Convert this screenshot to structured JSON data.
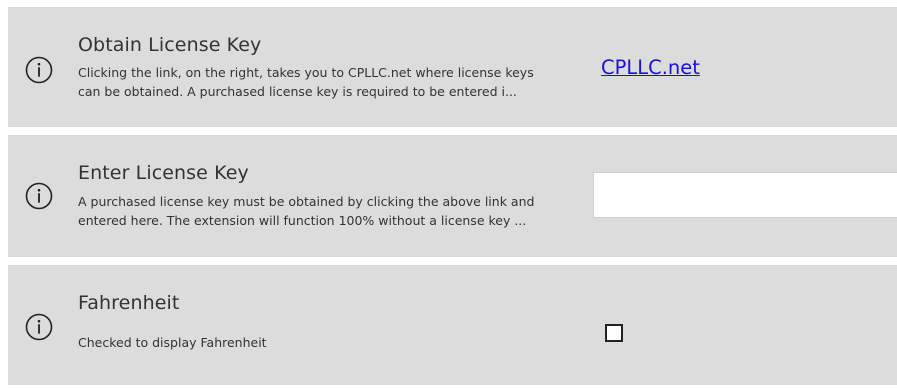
{
  "settings": [
    {
      "title": "Obtain License Key",
      "description_line1": "Clicking the link, on the right, takes you to CPLLC.net where license keys",
      "description_line2": "can be obtained.  A purchased license key is required to be entered i...",
      "link_text": "CPLLC.net",
      "icon": "info-icon"
    },
    {
      "title": "Enter License Key",
      "description_line1": "A purchased license key must be obtained by clicking the above link and",
      "description_line2": "entered here. The extension will function 100% without a license key ...",
      "input_value": "",
      "input_placeholder": "",
      "icon": "info-icon"
    },
    {
      "title": "Fahrenheit",
      "description_line1": "Checked to display Fahrenheit",
      "checked": false,
      "icon": "info-icon"
    }
  ],
  "colors": {
    "row_background": "#dcdcdc",
    "link": "#1a10d8",
    "text": "#333333"
  }
}
